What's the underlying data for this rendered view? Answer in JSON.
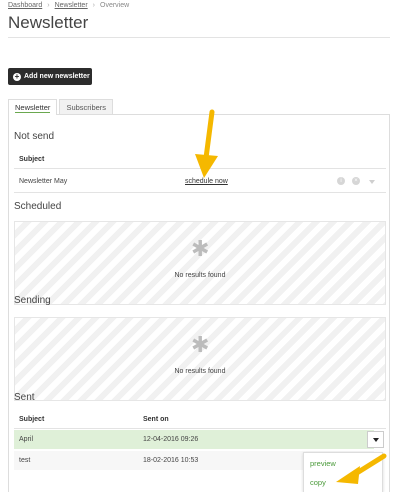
{
  "breadcrumb": {
    "items": [
      "Dashboard",
      "Newsletter",
      "Overview"
    ]
  },
  "page": {
    "title": "Newsletter"
  },
  "toolbar": {
    "add_label": "Add new newsletter"
  },
  "tabs": [
    {
      "label": "Newsletter",
      "active": true
    },
    {
      "label": "Subscribers",
      "active": false
    }
  ],
  "sections": {
    "not_send": {
      "title": "Not send",
      "header_subject": "Subject",
      "rows": [
        {
          "subject": "Newsletter May",
          "action": "schedule now"
        }
      ]
    },
    "scheduled": {
      "title": "Scheduled",
      "empty_text": "No results found"
    },
    "sending": {
      "title": "Sending",
      "empty_text": "No results found"
    },
    "sent": {
      "title": "Sent",
      "header_subject": "Subject",
      "header_sent_on": "Sent on",
      "rows": [
        {
          "subject": "April",
          "sent_on": "12-04-2016 09:26"
        },
        {
          "subject": "test",
          "sent_on": "18-02-2016 10:53"
        }
      ],
      "menu": [
        "preview",
        "copy"
      ]
    }
  },
  "colors": {
    "accent_green": "#4a9a3a",
    "highlight_row": "#dff0d8",
    "annotation_arrow": "#f5b800",
    "button_dark": "#2c2c2c"
  },
  "icons": [
    "plus-circle-icon",
    "empty-asterisk-icon",
    "delete-circle-icon",
    "chevron-down-icon",
    "annotation-arrow-icon"
  ]
}
